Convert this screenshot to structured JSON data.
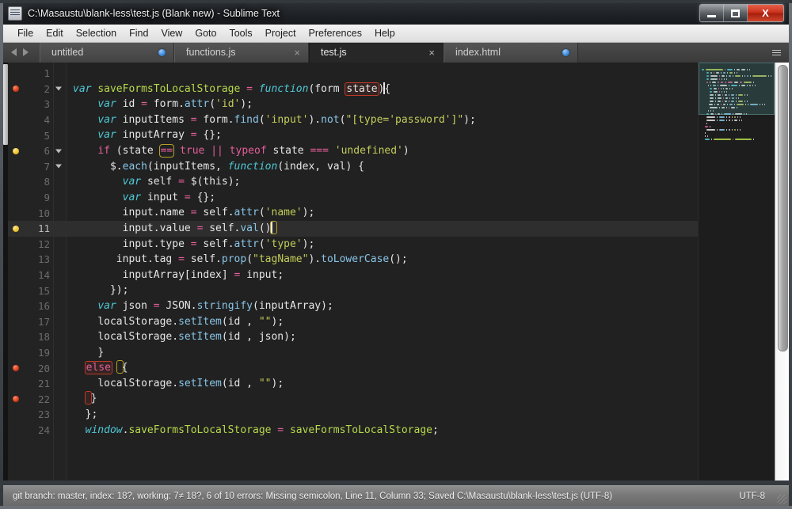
{
  "window": {
    "title": "C:\\Masaustu\\blank-less\\test.js (Blank new) - Sublime Text",
    "icon": "sublime-text-icon",
    "minimize_label": "",
    "maximize_label": "",
    "close_label": "X"
  },
  "menubar": {
    "items": [
      {
        "label": "File"
      },
      {
        "label": "Edit"
      },
      {
        "label": "Selection"
      },
      {
        "label": "Find"
      },
      {
        "label": "View"
      },
      {
        "label": "Goto"
      },
      {
        "label": "Tools"
      },
      {
        "label": "Project"
      },
      {
        "label": "Preferences"
      },
      {
        "label": "Help"
      }
    ]
  },
  "tabs": {
    "nav_prev": "◀",
    "nav_next": "▶",
    "menu_icon": "hamburger-icon",
    "items": [
      {
        "label": "untitled",
        "active": false,
        "dirty": true,
        "close": "×"
      },
      {
        "label": "functions.js",
        "active": false,
        "dirty": false,
        "close": "×"
      },
      {
        "label": "test.js",
        "active": true,
        "dirty": false,
        "close": "×"
      },
      {
        "label": "index.html",
        "active": false,
        "dirty": true,
        "close": "×"
      }
    ]
  },
  "editor": {
    "current_line": 11,
    "total_lines": 24,
    "lines": [
      {
        "n": 1,
        "marker": null,
        "fold": false,
        "text": ""
      },
      {
        "n": 2,
        "marker": "red",
        "fold": true,
        "text": "var saveFormsToLocalStorage = function(form state){"
      },
      {
        "n": 3,
        "marker": null,
        "fold": false,
        "text": "    var id = form.attr('id');"
      },
      {
        "n": 4,
        "marker": null,
        "fold": false,
        "text": "    var inputItems = form.find('input').not(\"[type='password']\");"
      },
      {
        "n": 5,
        "marker": null,
        "fold": false,
        "text": "    var inputArray = {};"
      },
      {
        "n": 6,
        "marker": "yellow",
        "fold": true,
        "text": "    if (state == true || typeof state === 'undefined')"
      },
      {
        "n": 7,
        "marker": null,
        "fold": true,
        "text": "      $.each(inputItems, function(index, val) {"
      },
      {
        "n": 8,
        "marker": null,
        "fold": false,
        "text": "        var self = $(this);"
      },
      {
        "n": 9,
        "marker": null,
        "fold": false,
        "text": "        var input = {};"
      },
      {
        "n": 10,
        "marker": null,
        "fold": false,
        "text": "        input.name = self.attr('name');"
      },
      {
        "n": 11,
        "marker": "yellow",
        "fold": false,
        "text": "        input.value = self.val()"
      },
      {
        "n": 12,
        "marker": null,
        "fold": false,
        "text": "        input.type = self.attr('type');"
      },
      {
        "n": 13,
        "marker": null,
        "fold": false,
        "text": "       input.tag = self.prop(\"tagName\").toLowerCase();"
      },
      {
        "n": 14,
        "marker": null,
        "fold": false,
        "text": "        inputArray[index] = input;"
      },
      {
        "n": 15,
        "marker": null,
        "fold": false,
        "text": "      });"
      },
      {
        "n": 16,
        "marker": null,
        "fold": false,
        "text": "    var json = JSON.stringify(inputArray);"
      },
      {
        "n": 17,
        "marker": null,
        "fold": false,
        "text": "    localStorage.setItem(id , \"\");"
      },
      {
        "n": 18,
        "marker": null,
        "fold": false,
        "text": "    localStorage.setItem(id , json);"
      },
      {
        "n": 19,
        "marker": null,
        "fold": false,
        "text": "    }"
      },
      {
        "n": 20,
        "marker": "red",
        "fold": false,
        "text": "  else {"
      },
      {
        "n": 21,
        "marker": null,
        "fold": false,
        "text": "    localStorage.setItem(id , \"\");"
      },
      {
        "n": 22,
        "marker": "red",
        "fold": false,
        "text": "  }"
      },
      {
        "n": 23,
        "marker": null,
        "fold": false,
        "text": "  };"
      },
      {
        "n": 24,
        "marker": null,
        "fold": false,
        "text": "  window.saveFormsToLocalStorage = saveFormsToLocalStorage;"
      }
    ]
  },
  "statusbar": {
    "left": "git branch: master, index: 18?, working: 7≠ 18?, 6 of 10 errors: Missing semicolon, Line 11, Column 33; Saved C:\\Masaustu\\blank-less\\test.js (UTF-8)",
    "right": "UTF-8"
  },
  "colors": {
    "editor_background": "#212121",
    "gutter_background": "#232323",
    "current_line_background": "#2e2e2e",
    "keyword": "#e55f9a",
    "storage_type": "#4ec9d6",
    "entity_name": "#b6d94c",
    "string": "#c3cc5a",
    "method": "#88c5e8",
    "plain_text": "#e6e6e6",
    "error_outline": "#c0392b",
    "bracket_match": "#b5a128",
    "marker_red": "#d63a17",
    "marker_yellow": "#e8c22a",
    "statusbar_background": "#787878",
    "titlebar_background": "#1d2024",
    "menubar_background": "#e9e9e9"
  }
}
